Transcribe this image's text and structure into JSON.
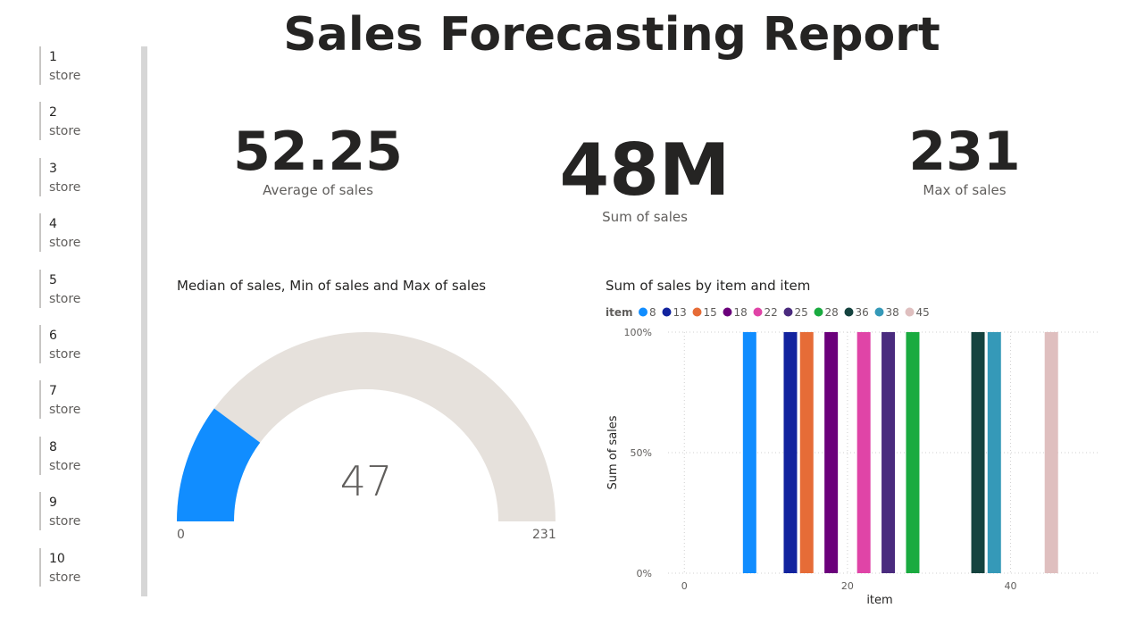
{
  "report": {
    "title": "Sales Forecasting Report"
  },
  "slicer": {
    "items": [
      {
        "num": "1",
        "label": "store"
      },
      {
        "num": "2",
        "label": "store"
      },
      {
        "num": "3",
        "label": "store"
      },
      {
        "num": "4",
        "label": "store"
      },
      {
        "num": "5",
        "label": "store"
      },
      {
        "num": "6",
        "label": "store"
      },
      {
        "num": "7",
        "label": "store"
      },
      {
        "num": "8",
        "label": "store"
      },
      {
        "num": "9",
        "label": "store"
      },
      {
        "num": "10",
        "label": "store"
      }
    ]
  },
  "cards": [
    {
      "value": "52.25",
      "label": "Average of sales"
    },
    {
      "value": "48M",
      "label": "Sum of sales"
    },
    {
      "value": "231",
      "label": "Max of sales"
    }
  ],
  "gauge": {
    "title": "Median of sales, Min of sales and Max of sales",
    "value": 47,
    "value_label": "47",
    "min": 0,
    "max": 231,
    "min_label": "0",
    "max_label": "231",
    "fill_color": "#118DFF",
    "track_color": "#E6E1DC"
  },
  "chart_data": {
    "type": "bar",
    "title": "Sum of sales by item and item",
    "xlabel": "item",
    "ylabel": "Sum of sales",
    "legend_title": "item",
    "legend_placement": "top-left",
    "xlim": [
      -2,
      51
    ],
    "ylim": [
      0,
      1
    ],
    "x_ticks": [
      0,
      20,
      40
    ],
    "x_tick_labels": [
      "0",
      "20",
      "40"
    ],
    "y_ticks": [
      0,
      0.5,
      1
    ],
    "y_tick_labels": [
      "0%",
      "50%",
      "100%"
    ],
    "grid": true,
    "series": [
      {
        "name": "8",
        "x": 8,
        "value": 1,
        "color": "#118DFF"
      },
      {
        "name": "13",
        "x": 13,
        "value": 1,
        "color": "#12239E"
      },
      {
        "name": "15",
        "x": 15,
        "value": 1,
        "color": "#E66C37"
      },
      {
        "name": "18",
        "x": 18,
        "value": 1,
        "color": "#6B007B"
      },
      {
        "name": "22",
        "x": 22,
        "value": 1,
        "color": "#E044A7"
      },
      {
        "name": "25",
        "x": 25,
        "value": 1,
        "color": "#4A2B7E"
      },
      {
        "name": "28",
        "x": 28,
        "value": 1,
        "color": "#1AAB40"
      },
      {
        "name": "36",
        "x": 36,
        "value": 1,
        "color": "#15433F"
      },
      {
        "name": "38",
        "x": 38,
        "value": 1,
        "color": "#3599B8"
      },
      {
        "name": "45",
        "x": 45,
        "value": 1,
        "color": "#DFBFBF"
      }
    ]
  }
}
